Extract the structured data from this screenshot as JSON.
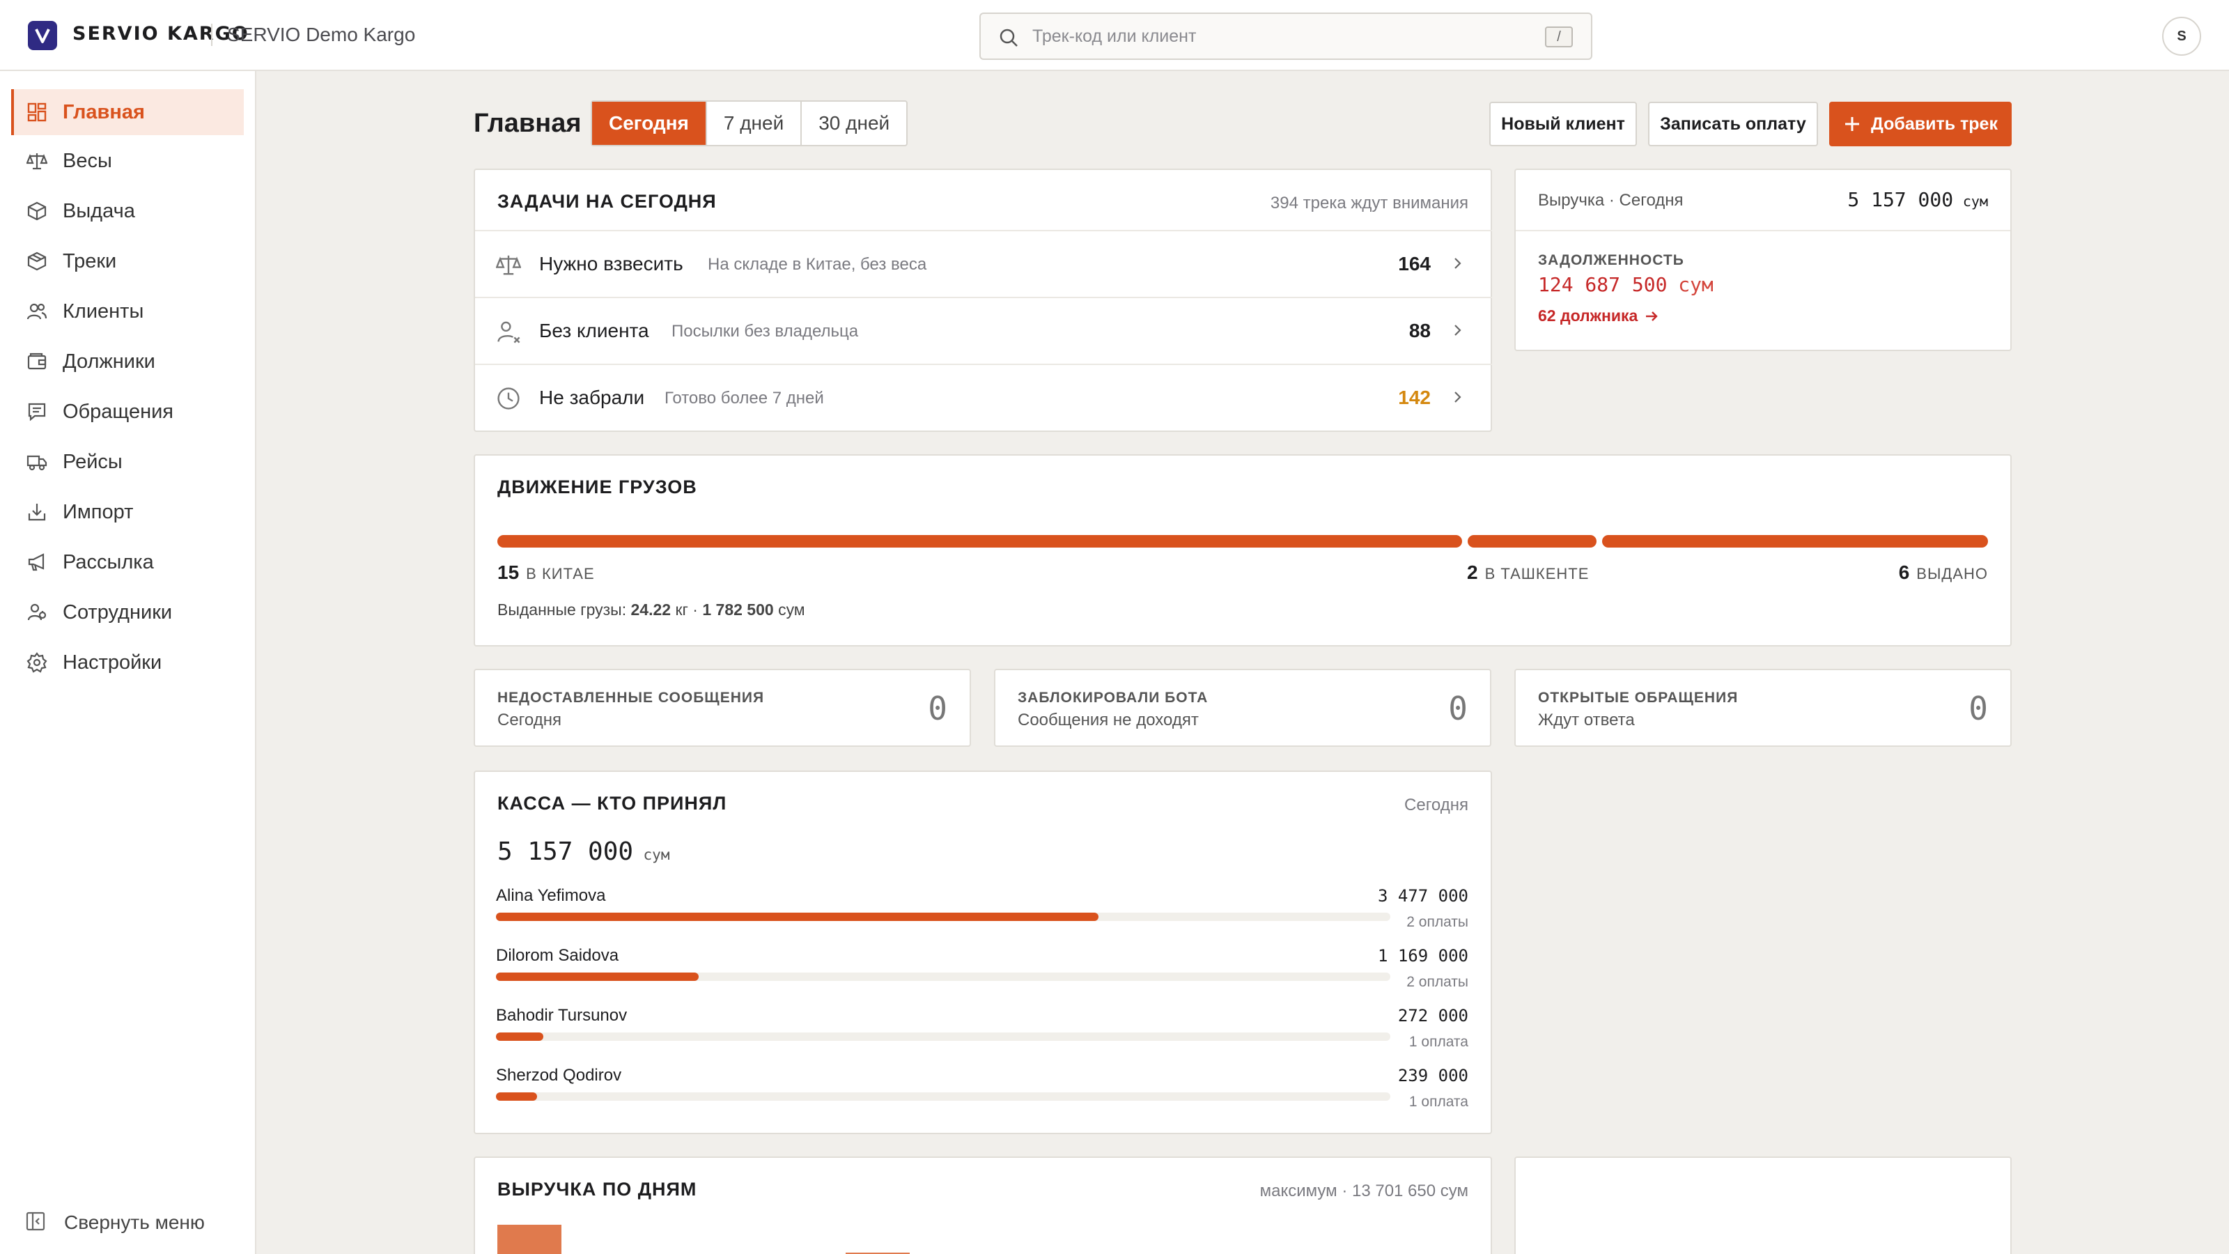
{
  "brand": {
    "name": "SERVIO KARGO",
    "org": "SERVIO Demo Kargo",
    "logo_letter": "V"
  },
  "search": {
    "placeholder": "Трек-код или клиент",
    "shortcut": "/"
  },
  "user": {
    "initial": "S"
  },
  "sidebar": {
    "items": [
      {
        "label": "Главная",
        "icon": "dashboard-icon",
        "active": true
      },
      {
        "label": "Весы",
        "icon": "scale-icon"
      },
      {
        "label": "Выдача",
        "icon": "box-icon"
      },
      {
        "label": "Треки",
        "icon": "package-icon"
      },
      {
        "label": "Клиенты",
        "icon": "users-icon"
      },
      {
        "label": "Должники",
        "icon": "wallet-icon"
      },
      {
        "label": "Обращения",
        "icon": "message-icon"
      },
      {
        "label": "Рейсы",
        "icon": "truck-icon"
      },
      {
        "label": "Импорт",
        "icon": "import-icon"
      },
      {
        "label": "Рассылка",
        "icon": "megaphone-icon"
      },
      {
        "label": "Сотрудники",
        "icon": "staff-icon"
      },
      {
        "label": "Настройки",
        "icon": "gear-icon"
      }
    ],
    "collapse_label": "Свернуть меню"
  },
  "header": {
    "title": "Главная",
    "periods": [
      "Сегодня",
      "7 дней",
      "30 дней"
    ],
    "active_period": "Сегодня",
    "buttons": {
      "new_client": "Новый клиент",
      "record_payment": "Записать оплату",
      "add_track": "Добавить трек"
    }
  },
  "tasks": {
    "title": "ЗАДАЧИ НА СЕГОДНЯ",
    "summary": "394 трека ждут внимания",
    "rows": [
      {
        "label": "Нужно взвесить",
        "sub": "На складе в Китае, без веса",
        "count": "164",
        "icon": "scale-icon"
      },
      {
        "label": "Без клиента",
        "sub": "Посылки без владельца",
        "count": "88",
        "icon": "user-x-icon"
      },
      {
        "label": "Не забрали",
        "sub": "Готово более 7 дней",
        "count": "142",
        "icon": "clock-icon"
      }
    ]
  },
  "revenue": {
    "label": "Выручка · Сегодня",
    "amount": "5 157 000",
    "currency": "сум",
    "debt_label": "ЗАДОЛЖЕННОСТЬ",
    "debt_amount": "124 687 500",
    "debt_currency": "сум",
    "debtors_link": "62 должника"
  },
  "flow": {
    "title": "ДВИЖЕНИЕ ГРУЗОВ",
    "segments": [
      {
        "count": "15",
        "label": "В КИТАЕ",
        "value": 15
      },
      {
        "count": "2",
        "label": "В ТАШКЕНТЕ",
        "value": 2
      },
      {
        "count": "6",
        "label": "ВЫДАНО",
        "value": 6
      }
    ],
    "issued_prefix": "Выданные грузы:",
    "issued_weight": "24.22",
    "weight_unit": "кг",
    "separator": "·",
    "issued_amount": "1 782 500",
    "issued_currency": "сум"
  },
  "stats": [
    {
      "label": "НЕДОСТАВЛЕННЫЕ СООБЩЕНИЯ",
      "sub": "Сегодня",
      "value": "0"
    },
    {
      "label": "ЗАБЛОКИРОВАЛИ БОТА",
      "sub": "Сообщения не доходят",
      "value": "0"
    },
    {
      "label": "ОТКРЫТЫЕ ОБРАЩЕНИЯ",
      "sub": "Ждут ответа",
      "value": "0"
    }
  ],
  "cash": {
    "title": "КАССА — КТО ПРИНЯЛ",
    "period": "Сегодня",
    "total": "5 157 000",
    "currency": "сум",
    "rows": [
      {
        "name": "Alina Yefimova",
        "amount": "3 477 000",
        "count": "2 оплаты",
        "share": 0.674
      },
      {
        "name": "Dilorom Saidova",
        "amount": "1 169 000",
        "count": "2 оплаты",
        "share": 0.227
      },
      {
        "name": "Bahodir Tursunov",
        "amount": "272 000",
        "count": "1 оплата",
        "share": 0.053
      },
      {
        "name": "Sherzod Qodirov",
        "amount": "239 000",
        "count": "1 оплата",
        "share": 0.046
      }
    ]
  },
  "daily": {
    "title": "ВЫРУЧКА ПО ДНЯМ",
    "max_label": "максимум · 13 701 650 сум"
  },
  "colors": {
    "accent": "#d9521d",
    "brand": "#2f2a83",
    "danger": "#c62828",
    "warning": "#d4880f"
  }
}
